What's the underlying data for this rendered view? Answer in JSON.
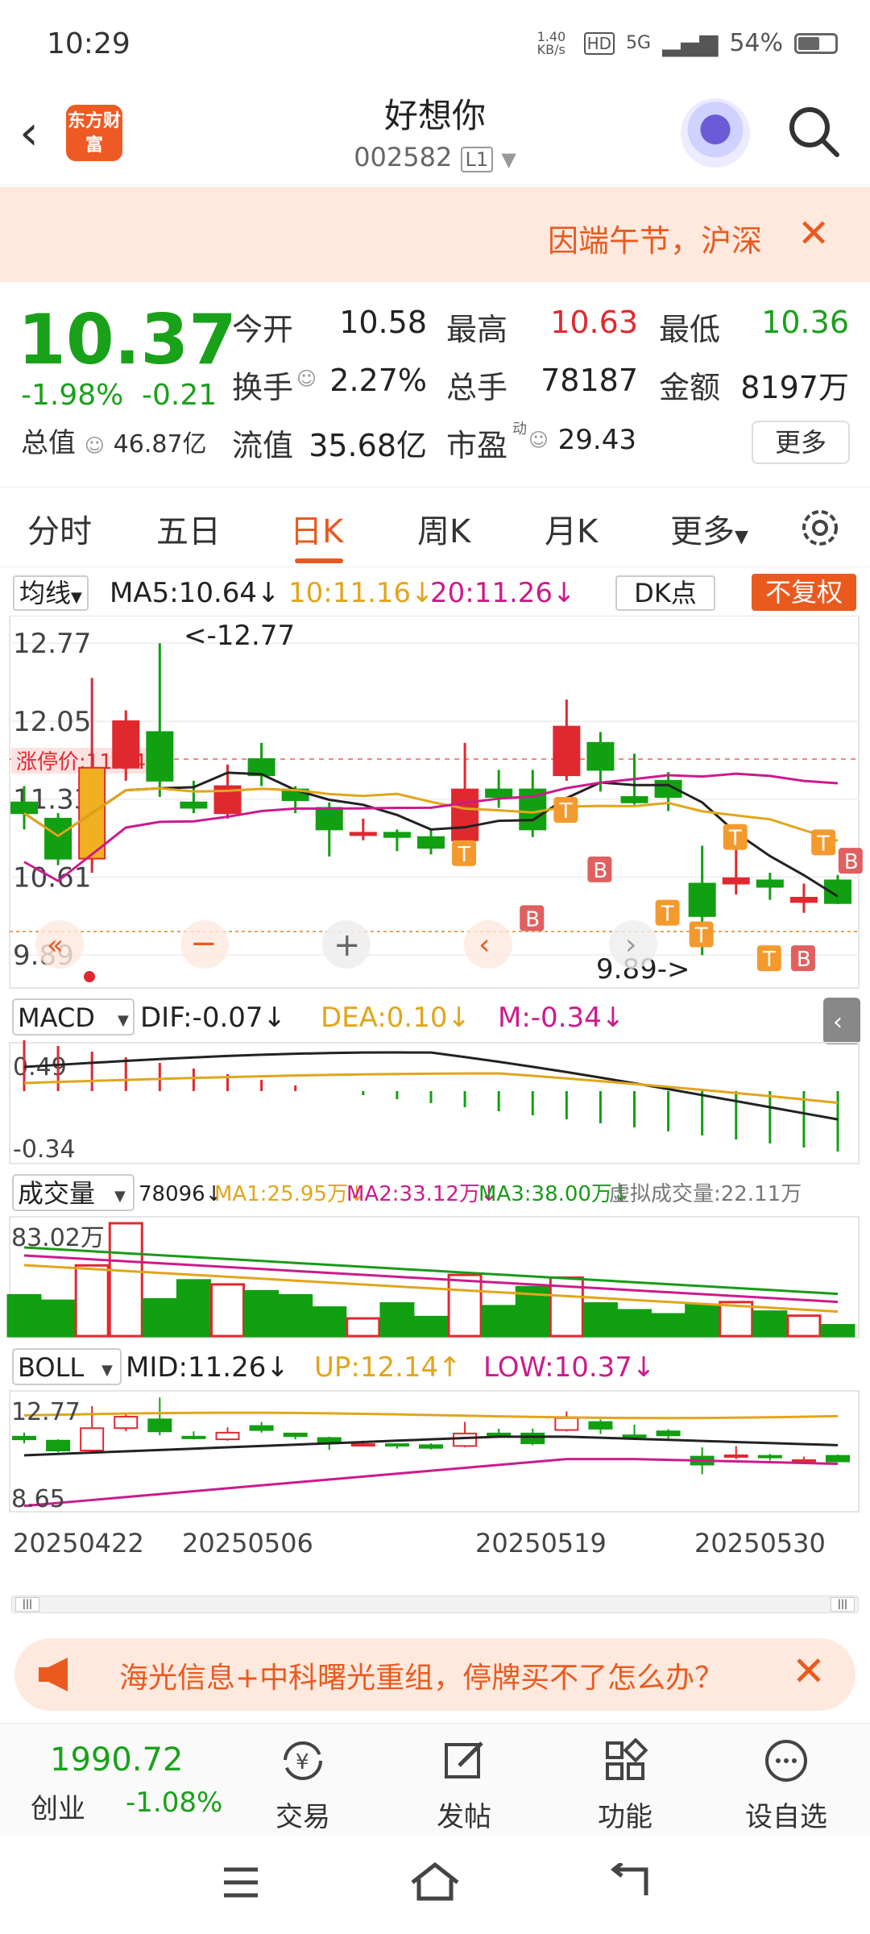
{
  "status": {
    "time": "10:29",
    "speed": "1.40 KB/s",
    "net": "5G",
    "battery": "54%"
  },
  "header": {
    "logo": "东方财富",
    "name": "好想你",
    "code": "002582",
    "level": "L1"
  },
  "banner": {
    "text": "因端午节，沪深",
    "close": "✕"
  },
  "quote": {
    "price": "10.37",
    "pct": "-1.98%",
    "chg": "-0.21",
    "mktcap_label": "总值",
    "mktcap": "46.87亿",
    "open_label": "今开",
    "open": "10.58",
    "high_label": "最高",
    "high": "10.63",
    "low_label": "最低",
    "low": "10.36",
    "turnover_label": "换手",
    "turnover": "2.27%",
    "vol_label": "总手",
    "vol": "78187",
    "amount_label": "金额",
    "amount": "8197万",
    "float_label": "流值",
    "float": "35.68亿",
    "pe_label": "市盈",
    "pe_tag": "动",
    "pe": "29.43",
    "more": "更多"
  },
  "tabs": [
    "分时",
    "五日",
    "日K",
    "周K",
    "月K",
    "更多"
  ],
  "chart": {
    "ma_selector": "均线",
    "ma5": "MA5:10.64↓",
    "ma10": "10:11.16↓",
    "ma20": "20:11.26↓",
    "dk": "DK点",
    "fuquan": "不复权",
    "y_labels": [
      "12.77",
      "12.05",
      "11.33",
      "10.61",
      "9.89"
    ],
    "limit_label": "涨停价:11.54",
    "max_note": "<-12.77",
    "min_note": "9.89->",
    "macd_selector": "MACD",
    "dif": "DIF:-0.07↓",
    "dea": "DEA:0.10↓",
    "m": "M:-0.34↓",
    "macd_hi": "0.49",
    "macd_lo": "-0.34",
    "vol_selector": "成交量",
    "vol_now": "78096↓",
    "vol_ma1": "MA1:25.95万↓",
    "vol_ma2": "MA2:33.12万↓",
    "vol_ma3": "MA3:38.00万↓",
    "vol_virtual": "虚拟成交量:22.11万",
    "vol_hi": "83.02万",
    "boll_selector": "BOLL",
    "mid": "MID:11.26↓",
    "up": "UP:12.14↑",
    "low": "LOW:10.37↓",
    "boll_hi": "12.77",
    "boll_lo": "8.65",
    "dates": [
      "20250422",
      "20250506",
      "20250519",
      "20250530"
    ]
  },
  "chart_data": {
    "type": "candlestick",
    "ohlc": [
      [
        11.3,
        11.2,
        11.45,
        11.05
      ],
      [
        11.15,
        10.78,
        11.2,
        10.72
      ],
      [
        10.78,
        11.62,
        12.45,
        10.65
      ],
      [
        11.62,
        12.05,
        12.15,
        11.5
      ],
      [
        11.95,
        11.5,
        12.77,
        11.35
      ],
      [
        11.3,
        11.25,
        11.5,
        11.2
      ],
      [
        11.2,
        11.45,
        11.65,
        11.15
      ],
      [
        11.7,
        11.55,
        11.85,
        11.45
      ],
      [
        11.42,
        11.32,
        11.45,
        11.2
      ],
      [
        11.25,
        11.05,
        11.3,
        10.8
      ],
      [
        11.02,
        11.02,
        11.15,
        10.95
      ],
      [
        11.02,
        10.98,
        11.05,
        10.85
      ],
      [
        10.98,
        10.88,
        11.05,
        10.82
      ],
      [
        10.95,
        11.42,
        11.85,
        10.9
      ],
      [
        11.42,
        11.35,
        11.6,
        11.25
      ],
      [
        11.42,
        11.05,
        11.6,
        10.98
      ],
      [
        11.55,
        12.0,
        12.25,
        11.5
      ],
      [
        11.85,
        11.6,
        11.95,
        11.4
      ],
      [
        11.35,
        11.3,
        11.75,
        11.28
      ],
      [
        11.5,
        11.35,
        11.58,
        11.22
      ],
      [
        10.55,
        10.25,
        10.9,
        9.89
      ],
      [
        10.55,
        10.6,
        10.95,
        10.45
      ],
      [
        10.58,
        10.52,
        10.65,
        10.4
      ],
      [
        10.38,
        10.42,
        10.55,
        10.28
      ],
      [
        10.58,
        10.37,
        10.63,
        10.36
      ]
    ],
    "volume": [
      30,
      26,
      52,
      83,
      27,
      41,
      38,
      33,
      30,
      21,
      13,
      24,
      14,
      45,
      22,
      36,
      43,
      24,
      19,
      16,
      23,
      25,
      18,
      15,
      8
    ]
  }
}
